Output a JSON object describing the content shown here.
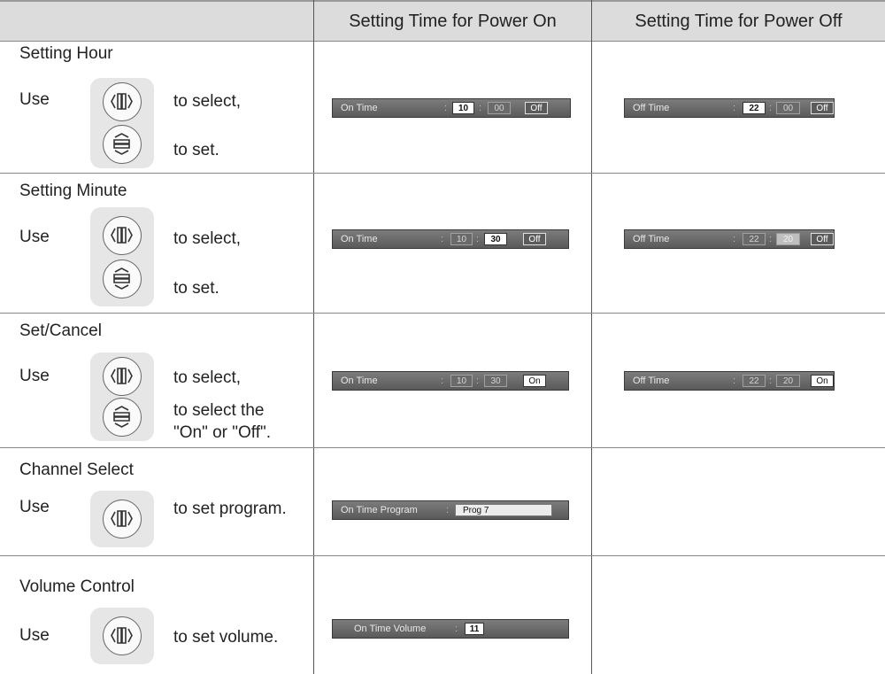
{
  "headers": {
    "col1": "",
    "col2": "Setting Time for Power On",
    "col3": "Setting Time for Power Off"
  },
  "rows": [
    {
      "title": "Setting Hour",
      "use": "Use",
      "desc_select": "to select,",
      "desc_set": "to set.",
      "on": {
        "label": "On Time",
        "hour": "10",
        "minute": "00",
        "toggle": "Off"
      },
      "off": {
        "label": "Off Time",
        "hour": "22",
        "minute": "00",
        "toggle": "Off"
      }
    },
    {
      "title": "Setting Minute",
      "use": "Use",
      "desc_select": "to select,",
      "desc_set": "to set.",
      "on": {
        "label": "On Time",
        "hour": "10",
        "minute": "30",
        "toggle": "Off"
      },
      "off": {
        "label": "Off Time",
        "hour": "22",
        "minute": "20",
        "toggle": "Off"
      }
    },
    {
      "title": "Set/Cancel",
      "use": "Use",
      "desc_select": "to select,",
      "desc_set_line1": "to select the",
      "desc_set_line2": "\"On\" or \"Off\".",
      "on": {
        "label": "On Time",
        "hour": "10",
        "minute": "30",
        "toggle": "On"
      },
      "off": {
        "label": "Off Time",
        "hour": "22",
        "minute": "20",
        "toggle": "On"
      }
    },
    {
      "title": "Channel Select",
      "use": "Use",
      "desc": "to set program.",
      "on": {
        "label": "On Time Program",
        "value": "Prog 7"
      }
    },
    {
      "title": "Volume Control",
      "use": "Use",
      "desc": "to set volume.",
      "on": {
        "label": "On Time Volume",
        "value": "11"
      }
    }
  ],
  "colon": ":",
  "icons": {
    "left_right": "left-right-button-icon",
    "up_down": "up-down-button-icon"
  }
}
